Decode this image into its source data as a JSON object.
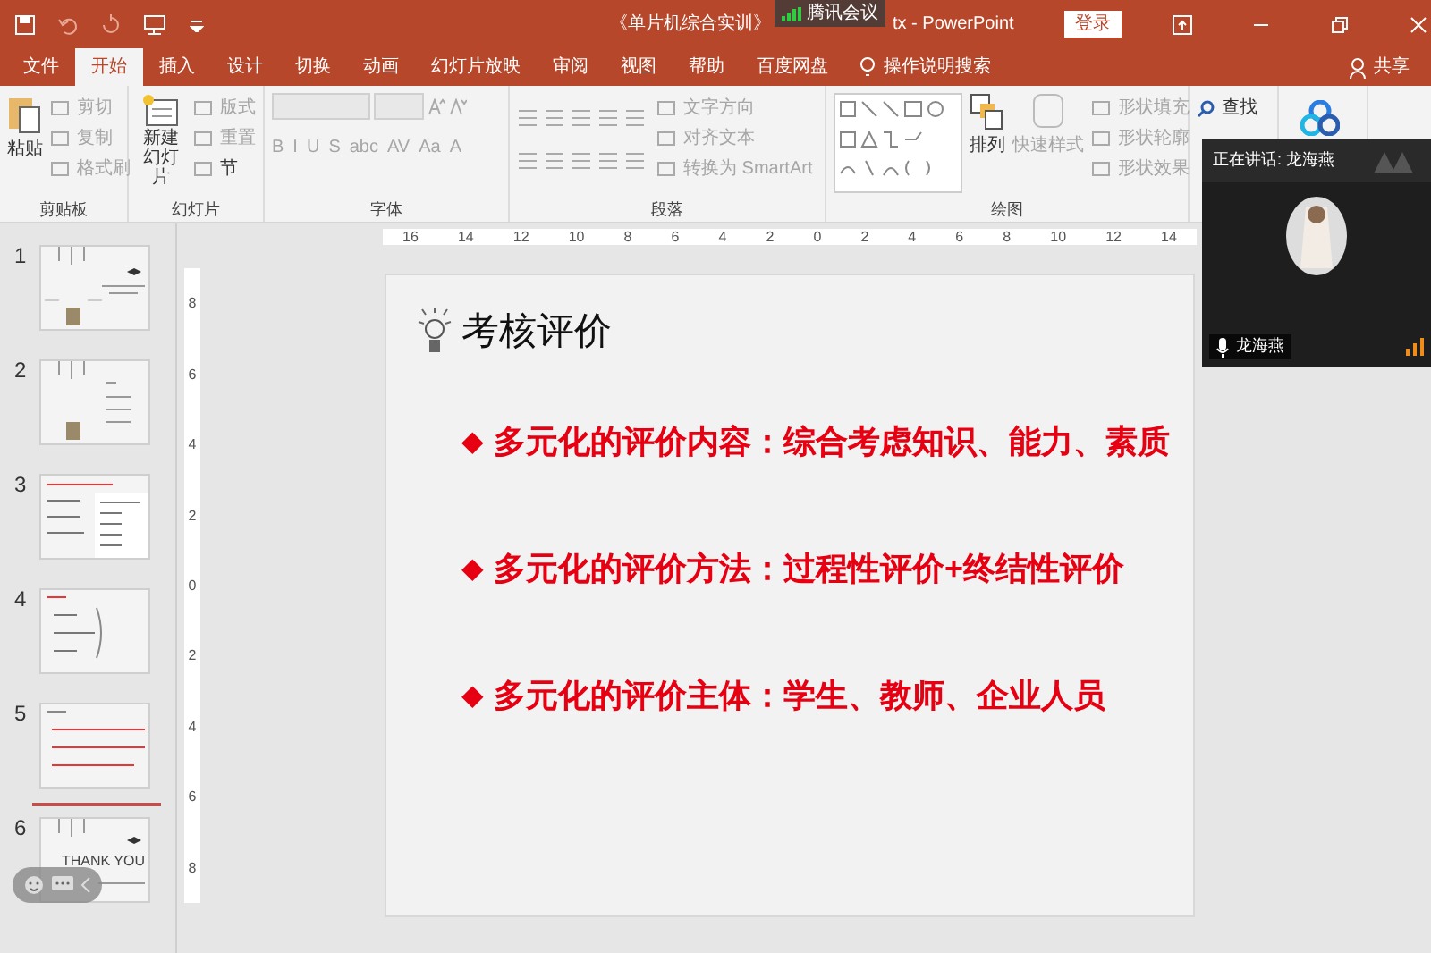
{
  "window": {
    "title_left": "《单片机综合实训》",
    "title_right": "tx - PowerPoint",
    "login": "登录"
  },
  "meeting_badge": "腾讯会议",
  "tabs": [
    {
      "label": "文件",
      "selected": false
    },
    {
      "label": "开始",
      "selected": true
    },
    {
      "label": "插入",
      "selected": false
    },
    {
      "label": "设计",
      "selected": false
    },
    {
      "label": "切换",
      "selected": false
    },
    {
      "label": "动画",
      "selected": false
    },
    {
      "label": "幻灯片放映",
      "selected": false
    },
    {
      "label": "审阅",
      "selected": false
    },
    {
      "label": "视图",
      "selected": false
    },
    {
      "label": "帮助",
      "selected": false
    },
    {
      "label": "百度网盘",
      "selected": false
    }
  ],
  "tell_me": "操作说明搜索",
  "share": "共享",
  "ribbon": {
    "clipboard": {
      "label": "剪贴板",
      "paste": "粘贴",
      "items": [
        {
          "label": "剪切",
          "disabled": true
        },
        {
          "label": "复制",
          "disabled": true
        },
        {
          "label": "格式刷",
          "disabled": true
        }
      ]
    },
    "slides": {
      "label": "幻灯片",
      "new_slide": [
        "新建",
        "幻灯片"
      ],
      "items": [
        {
          "label": "版式",
          "disabled": true
        },
        {
          "label": "重置",
          "disabled": true
        },
        {
          "label": "节",
          "disabled": false
        }
      ]
    },
    "font": {
      "label": "字体",
      "buttons": [
        "B",
        "I",
        "U",
        "S",
        "abc",
        "AV",
        "Aa",
        "A"
      ]
    },
    "paragraph": {
      "label": "段落",
      "items": [
        {
          "label": "文字方向",
          "disabled": true
        },
        {
          "label": "对齐文本",
          "disabled": true
        },
        {
          "label": "转换为 SmartArt",
          "disabled": true
        }
      ]
    },
    "drawing": {
      "label": "绘图",
      "arrange": "排列",
      "quick_styles": "快速样式",
      "items": [
        {
          "label": "形状填充",
          "disabled": true
        },
        {
          "label": "形状轮廓",
          "disabled": true
        },
        {
          "label": "形状效果",
          "disabled": true
        }
      ]
    },
    "editing": {
      "find": "查找"
    }
  },
  "rulers": {
    "horizontal": [
      "16",
      "14",
      "12",
      "10",
      "8",
      "6",
      "4",
      "2",
      "0",
      "2",
      "4",
      "6",
      "8",
      "10",
      "12",
      "14"
    ],
    "vertical": [
      "8",
      "6",
      "4",
      "2",
      "0",
      "2",
      "4",
      "6",
      "8"
    ]
  },
  "thumbnails": [
    {
      "number": "1",
      "kind": "cover"
    },
    {
      "number": "2",
      "kind": "agenda"
    },
    {
      "number": "3",
      "kind": "table"
    },
    {
      "number": "4",
      "kind": "outline"
    },
    {
      "number": "5",
      "kind": "bullets"
    },
    {
      "number": "6",
      "kind": "thanks",
      "text": "THANK YOU"
    }
  ],
  "slide": {
    "title": "考核评价",
    "bullets": [
      {
        "marker": "◆",
        "text": "多元化的评价内容：综合考虑知识、能力、素质"
      },
      {
        "marker": "◆",
        "text": "多元化的评价方法：过程性评价+终结性评价"
      },
      {
        "marker": "◆",
        "text": "多元化的评价主体：学生、教师、企业人员"
      }
    ]
  },
  "meeting": {
    "speaking": "正在讲话: 龙海燕",
    "participant": "龙海燕"
  }
}
